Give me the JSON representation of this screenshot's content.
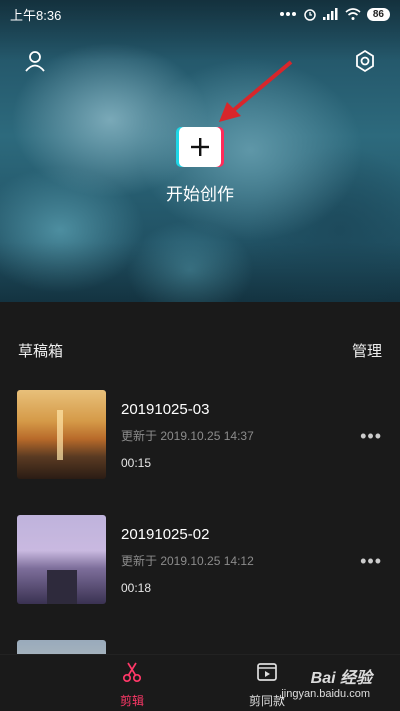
{
  "status_bar": {
    "time": "上午8:36",
    "battery": "86"
  },
  "hero": {
    "create_label": "开始创作"
  },
  "drafts": {
    "title": "草稿箱",
    "manage_label": "管理",
    "items": [
      {
        "name": "20191025-03",
        "updated": "更新于 2019.10.25 14:37",
        "duration": "00:15"
      },
      {
        "name": "20191025-02",
        "updated": "更新于 2019.10.25 14:12",
        "duration": "00:18"
      }
    ],
    "more_label": "•••"
  },
  "bottom_nav": {
    "items": [
      {
        "label": "剪辑",
        "icon": "scissors-icon",
        "active": true
      },
      {
        "label": "剪同款",
        "icon": "film-clip-icon",
        "active": false
      }
    ]
  },
  "watermark": {
    "main": "Bai 经验",
    "sub": "jingyan.baidu.com"
  },
  "colors": {
    "accent": "#ff3868",
    "background": "#1a1a1a",
    "cyan": "#1fd6e6"
  }
}
